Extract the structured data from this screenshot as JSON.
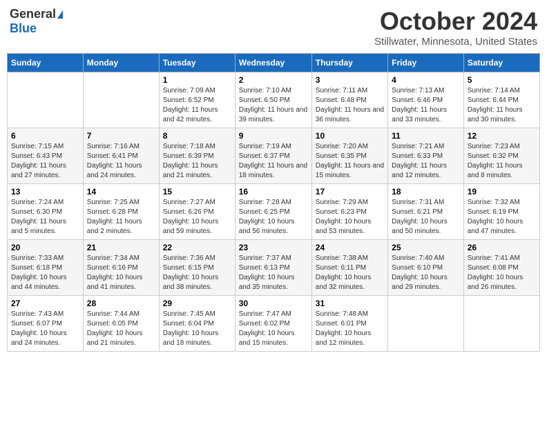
{
  "header": {
    "logo_general": "General",
    "logo_blue": "Blue",
    "month_title": "October 2024",
    "location": "Stillwater, Minnesota, United States"
  },
  "weekdays": [
    "Sunday",
    "Monday",
    "Tuesday",
    "Wednesday",
    "Thursday",
    "Friday",
    "Saturday"
  ],
  "weeks": [
    [
      {
        "day": "",
        "sunrise": "",
        "sunset": "",
        "daylight": ""
      },
      {
        "day": "",
        "sunrise": "",
        "sunset": "",
        "daylight": ""
      },
      {
        "day": "1",
        "sunrise": "Sunrise: 7:09 AM",
        "sunset": "Sunset: 6:52 PM",
        "daylight": "Daylight: 11 hours and 42 minutes."
      },
      {
        "day": "2",
        "sunrise": "Sunrise: 7:10 AM",
        "sunset": "Sunset: 6:50 PM",
        "daylight": "Daylight: 11 hours and 39 minutes."
      },
      {
        "day": "3",
        "sunrise": "Sunrise: 7:11 AM",
        "sunset": "Sunset: 6:48 PM",
        "daylight": "Daylight: 11 hours and 36 minutes."
      },
      {
        "day": "4",
        "sunrise": "Sunrise: 7:13 AM",
        "sunset": "Sunset: 6:46 PM",
        "daylight": "Daylight: 11 hours and 33 minutes."
      },
      {
        "day": "5",
        "sunrise": "Sunrise: 7:14 AM",
        "sunset": "Sunset: 6:44 PM",
        "daylight": "Daylight: 11 hours and 30 minutes."
      }
    ],
    [
      {
        "day": "6",
        "sunrise": "Sunrise: 7:15 AM",
        "sunset": "Sunset: 6:43 PM",
        "daylight": "Daylight: 11 hours and 27 minutes."
      },
      {
        "day": "7",
        "sunrise": "Sunrise: 7:16 AM",
        "sunset": "Sunset: 6:41 PM",
        "daylight": "Daylight: 11 hours and 24 minutes."
      },
      {
        "day": "8",
        "sunrise": "Sunrise: 7:18 AM",
        "sunset": "Sunset: 6:39 PM",
        "daylight": "Daylight: 11 hours and 21 minutes."
      },
      {
        "day": "9",
        "sunrise": "Sunrise: 7:19 AM",
        "sunset": "Sunset: 6:37 PM",
        "daylight": "Daylight: 11 hours and 18 minutes."
      },
      {
        "day": "10",
        "sunrise": "Sunrise: 7:20 AM",
        "sunset": "Sunset: 6:35 PM",
        "daylight": "Daylight: 11 hours and 15 minutes."
      },
      {
        "day": "11",
        "sunrise": "Sunrise: 7:21 AM",
        "sunset": "Sunset: 6:33 PM",
        "daylight": "Daylight: 11 hours and 12 minutes."
      },
      {
        "day": "12",
        "sunrise": "Sunrise: 7:23 AM",
        "sunset": "Sunset: 6:32 PM",
        "daylight": "Daylight: 11 hours and 8 minutes."
      }
    ],
    [
      {
        "day": "13",
        "sunrise": "Sunrise: 7:24 AM",
        "sunset": "Sunset: 6:30 PM",
        "daylight": "Daylight: 11 hours and 5 minutes."
      },
      {
        "day": "14",
        "sunrise": "Sunrise: 7:25 AM",
        "sunset": "Sunset: 6:28 PM",
        "daylight": "Daylight: 11 hours and 2 minutes."
      },
      {
        "day": "15",
        "sunrise": "Sunrise: 7:27 AM",
        "sunset": "Sunset: 6:26 PM",
        "daylight": "Daylight: 10 hours and 59 minutes."
      },
      {
        "day": "16",
        "sunrise": "Sunrise: 7:28 AM",
        "sunset": "Sunset: 6:25 PM",
        "daylight": "Daylight: 10 hours and 56 minutes."
      },
      {
        "day": "17",
        "sunrise": "Sunrise: 7:29 AM",
        "sunset": "Sunset: 6:23 PM",
        "daylight": "Daylight: 10 hours and 53 minutes."
      },
      {
        "day": "18",
        "sunrise": "Sunrise: 7:31 AM",
        "sunset": "Sunset: 6:21 PM",
        "daylight": "Daylight: 10 hours and 50 minutes."
      },
      {
        "day": "19",
        "sunrise": "Sunrise: 7:32 AM",
        "sunset": "Sunset: 6:19 PM",
        "daylight": "Daylight: 10 hours and 47 minutes."
      }
    ],
    [
      {
        "day": "20",
        "sunrise": "Sunrise: 7:33 AM",
        "sunset": "Sunset: 6:18 PM",
        "daylight": "Daylight: 10 hours and 44 minutes."
      },
      {
        "day": "21",
        "sunrise": "Sunrise: 7:34 AM",
        "sunset": "Sunset: 6:16 PM",
        "daylight": "Daylight: 10 hours and 41 minutes."
      },
      {
        "day": "22",
        "sunrise": "Sunrise: 7:36 AM",
        "sunset": "Sunset: 6:15 PM",
        "daylight": "Daylight: 10 hours and 38 minutes."
      },
      {
        "day": "23",
        "sunrise": "Sunrise: 7:37 AM",
        "sunset": "Sunset: 6:13 PM",
        "daylight": "Daylight: 10 hours and 35 minutes."
      },
      {
        "day": "24",
        "sunrise": "Sunrise: 7:38 AM",
        "sunset": "Sunset: 6:11 PM",
        "daylight": "Daylight: 10 hours and 32 minutes."
      },
      {
        "day": "25",
        "sunrise": "Sunrise: 7:40 AM",
        "sunset": "Sunset: 6:10 PM",
        "daylight": "Daylight: 10 hours and 29 minutes."
      },
      {
        "day": "26",
        "sunrise": "Sunrise: 7:41 AM",
        "sunset": "Sunset: 6:08 PM",
        "daylight": "Daylight: 10 hours and 26 minutes."
      }
    ],
    [
      {
        "day": "27",
        "sunrise": "Sunrise: 7:43 AM",
        "sunset": "Sunset: 6:07 PM",
        "daylight": "Daylight: 10 hours and 24 minutes."
      },
      {
        "day": "28",
        "sunrise": "Sunrise: 7:44 AM",
        "sunset": "Sunset: 6:05 PM",
        "daylight": "Daylight: 10 hours and 21 minutes."
      },
      {
        "day": "29",
        "sunrise": "Sunrise: 7:45 AM",
        "sunset": "Sunset: 6:04 PM",
        "daylight": "Daylight: 10 hours and 18 minutes."
      },
      {
        "day": "30",
        "sunrise": "Sunrise: 7:47 AM",
        "sunset": "Sunset: 6:02 PM",
        "daylight": "Daylight: 10 hours and 15 minutes."
      },
      {
        "day": "31",
        "sunrise": "Sunrise: 7:48 AM",
        "sunset": "Sunset: 6:01 PM",
        "daylight": "Daylight: 10 hours and 12 minutes."
      },
      {
        "day": "",
        "sunrise": "",
        "sunset": "",
        "daylight": ""
      },
      {
        "day": "",
        "sunrise": "",
        "sunset": "",
        "daylight": ""
      }
    ]
  ]
}
